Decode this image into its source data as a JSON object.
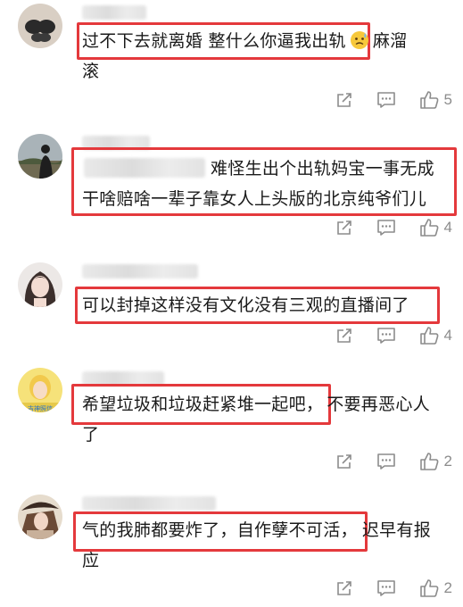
{
  "comments": [
    {
      "text_line1": "过不下去就离婚 整什么你逼我出轨",
      "text_after_emoji": "麻溜",
      "text_line2": "滚",
      "likes": "5"
    },
    {
      "text_line1_tail": "难怪生出个出轨妈宝一事无成",
      "text_line2": "干啥赔啥一辈子靠女人上头版的北京纯爷们儿",
      "likes": "4"
    },
    {
      "text_line1": "可以封掉这样没有文化没有三观的直播间了",
      "likes": "4"
    },
    {
      "text_line1": "希望垃圾和垃圾赶紧堆一起吧，",
      "text_line1_tail": "不要再恶心人",
      "text_line2": "了",
      "avatar_badge": "吉神照信",
      "likes": "2"
    },
    {
      "text_line1": "气的我肺都要炸了，自作孽不可活，",
      "text_line1_tail": "迟早有报",
      "text_line2": "应",
      "likes": "2"
    }
  ],
  "icons": {
    "share": "share-icon",
    "reply": "comment-icon",
    "like": "thumbs-up-icon",
    "emoji": "sweat-emoji-icon"
  },
  "colors": {
    "highlight": "#e4393c",
    "icon_gray": "#8c8c8c"
  }
}
